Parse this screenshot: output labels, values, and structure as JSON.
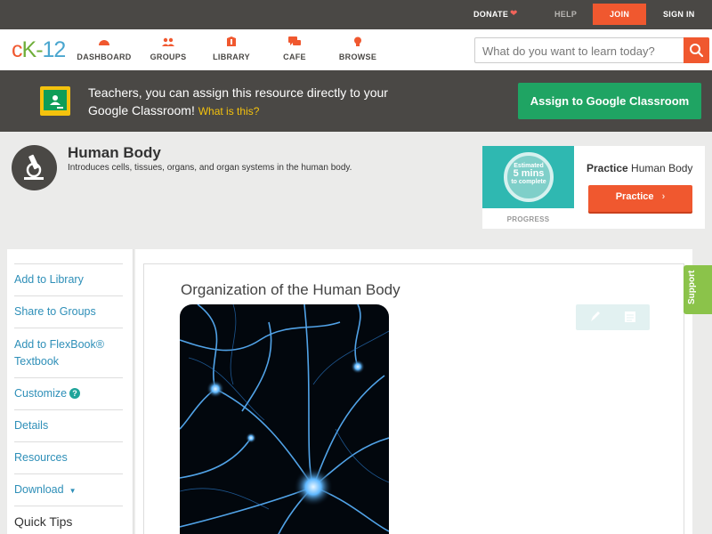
{
  "topbar": {
    "donate": "DONATE",
    "help": "HELP",
    "join": "JOIN",
    "signin": "SIGN IN"
  },
  "logo": {
    "c": "c",
    "k": "K",
    "dash": "-",
    "num": "12"
  },
  "nav": {
    "dashboard": "DASHBOARD",
    "groups": "GROUPS",
    "library": "LIBRARY",
    "cafe": "CAFE",
    "browse": "BROWSE"
  },
  "search": {
    "placeholder": "What do you want to learn today?"
  },
  "classroom": {
    "text": "Teachers, you can assign this resource directly to your Google Classroom!",
    "what": "What is this?",
    "button": "Assign to Google Classroom"
  },
  "concept": {
    "title": "Human Body",
    "description": "Introduces cells, tissues, organs, and organ systems in the human body."
  },
  "practice": {
    "estimated_line1": "Estimated",
    "estimated_line2": "5 mins",
    "estimated_line3": "to complete",
    "progress_label": "PROGRESS",
    "heading_bold": "Practice",
    "heading_rest": "Human Body",
    "button": "Practice"
  },
  "sidebar": {
    "items": [
      "Add to Library",
      "Share to Groups",
      "Add to FlexBook® Textbook",
      "Customize",
      "Details",
      "Resources",
      "Download"
    ],
    "quick_tips": "Quick Tips"
  },
  "content": {
    "title": "Organization of the Human Body"
  },
  "support": "Support",
  "colors": {
    "accent_orange": "#f0582f",
    "dark_bar": "#4a4845",
    "link_blue": "#2e8fb8",
    "classroom_green": "#1fa463",
    "support_green": "#8bc34a"
  }
}
